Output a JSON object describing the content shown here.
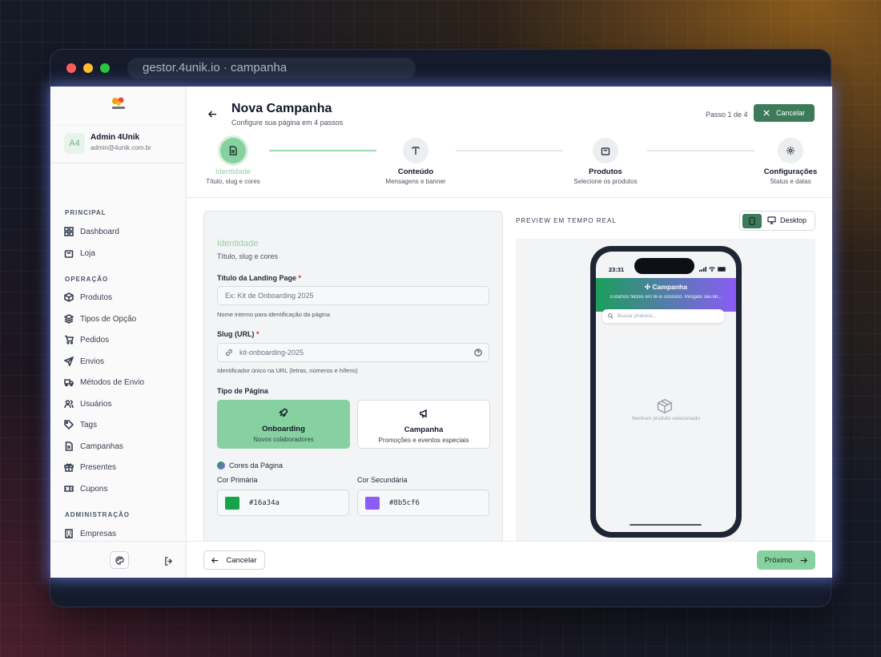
{
  "browser": {
    "url": "gestor.4unik.io · campanha"
  },
  "user": {
    "initials": "A4",
    "name": "Admin 4Unik",
    "email": "admin@4unik.com.br"
  },
  "logo_text": "4UNIK",
  "sidebar": {
    "sections": [
      "PRINCIPAL",
      "OPERAÇÃO",
      "ADMINISTRAÇÃO"
    ],
    "items": [
      {
        "label": "Dashboard",
        "icon": "grid-icon"
      },
      {
        "label": "Loja",
        "icon": "bag-icon"
      },
      {
        "label": "Produtos",
        "icon": "cube-icon"
      },
      {
        "label": "Tipos de Opção",
        "icon": "layers-icon"
      },
      {
        "label": "Pedidos",
        "icon": "cart-icon"
      },
      {
        "label": "Envios",
        "icon": "send-icon"
      },
      {
        "label": "Métodos de Envio",
        "icon": "truck-icon"
      },
      {
        "label": "Usuários",
        "icon": "users-icon"
      },
      {
        "label": "Tags",
        "icon": "tag-icon"
      },
      {
        "label": "Campanhas",
        "icon": "file-icon"
      },
      {
        "label": "Presentes",
        "icon": "gift-icon"
      },
      {
        "label": "Cupons",
        "icon": "ticket-icon"
      },
      {
        "label": "Empresas",
        "icon": "building-icon"
      }
    ]
  },
  "header": {
    "title": "Nova Campanha",
    "subtitle": "Configure sua página em 4 passos",
    "step_indicator": "Passo 1 de 4",
    "cancel": "Cancelar"
  },
  "steps": [
    {
      "label": "Identidade",
      "desc": "Título, slug e cores"
    },
    {
      "label": "Conteúdo",
      "desc": "Mensagens e banner"
    },
    {
      "label": "Produtos",
      "desc": "Selecione os produtos"
    },
    {
      "label": "Configurações",
      "desc": "Status e datas"
    }
  ],
  "form": {
    "section_title": "Identidade",
    "section_sub": "Título, slug e cores",
    "title_label": "Título da Landing Page",
    "title_placeholder": "Ex: Kit de Onboarding 2025",
    "title_help": "Nome interno para identificação da página",
    "slug_label": "Slug (URL)",
    "slug_value": "kit-onboarding-2025",
    "slug_help": "Identificador único na URL (letras, números e hífens)",
    "type_label": "Tipo de Página",
    "types": [
      {
        "title": "Onboarding",
        "desc": "Novos colaboradores",
        "selected": true
      },
      {
        "title": "Campanha",
        "desc": "Promoções e eventos especiais",
        "selected": false
      }
    ],
    "colors_label": "Cores da Página",
    "primary_label": "Cor Primária",
    "primary_value": "#16a34a",
    "secondary_label": "Cor Secundária",
    "secondary_value": "#8b5cf6"
  },
  "preview": {
    "label": "PREVIEW EM TEMPO REAL",
    "desktop": "Desktop",
    "time": "23:31",
    "banner_title": "Campanha",
    "banner_sub": "Estamos felizes em tê-lo conosco. Resgate seu kit...",
    "search_placeholder": "Buscar produtos...",
    "empty": "Nenhum produto selecionado"
  },
  "footer": {
    "cancel": "Cancelar",
    "next": "Próximo"
  },
  "colors": {
    "accent": "#3d7a5a",
    "accent_light": "#86d19f",
    "onboarding_bg": "#86d19f"
  }
}
